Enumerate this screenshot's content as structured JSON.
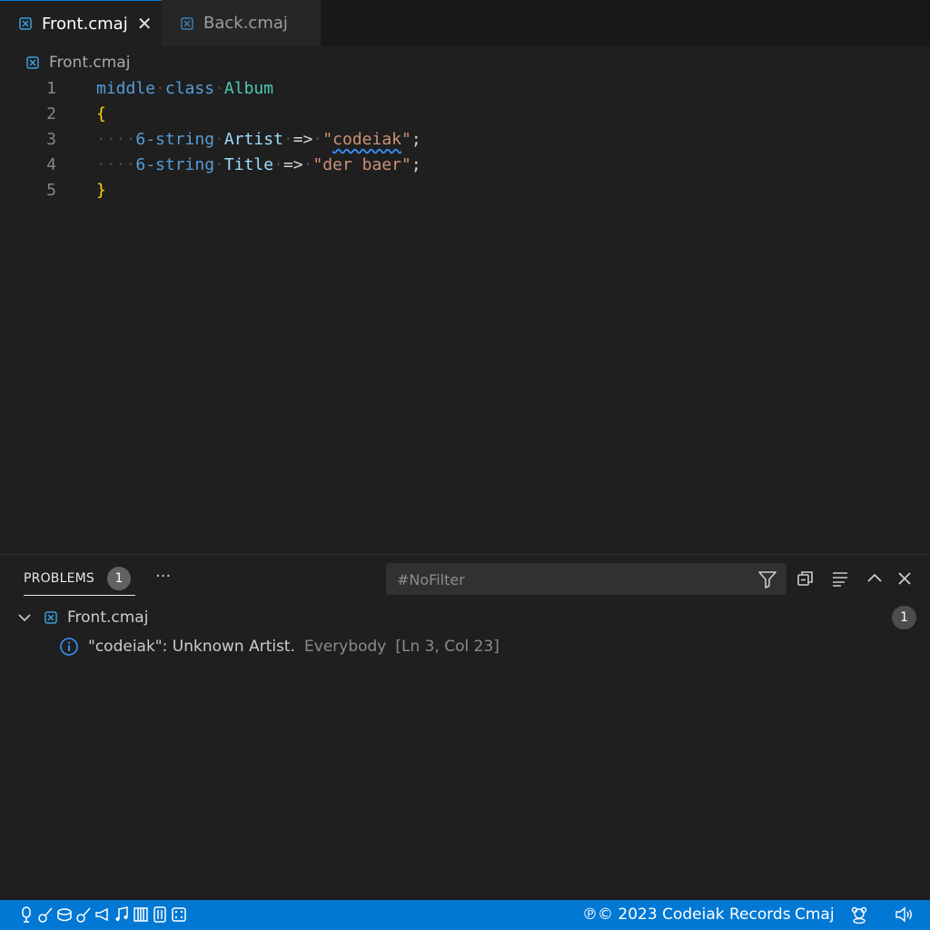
{
  "tabs": [
    {
      "label": "Front.cmaj",
      "active": true
    },
    {
      "label": "Back.cmaj",
      "active": false
    }
  ],
  "breadcrumb": {
    "label": "Front.cmaj"
  },
  "editor": {
    "lines": [
      {
        "num": "1"
      },
      {
        "num": "2"
      },
      {
        "num": "3"
      },
      {
        "num": "4"
      },
      {
        "num": "5"
      }
    ],
    "tokens": {
      "l1_kw1": "middle",
      "l1_kw2": "class",
      "l1_cls": "Album",
      "l2_brace": "{",
      "l3_type": "6-string",
      "l3_id": "Artist",
      "l3_op": "=>",
      "l3_q1": "\"",
      "l3_str": "codeiak",
      "l3_q2": "\"",
      "l3_semi": ";",
      "l4_type": "6-string",
      "l4_id": "Title",
      "l4_op": "=>",
      "l4_str": "\"der baer\"",
      "l4_semi": ";",
      "l5_brace": "}"
    }
  },
  "panel": {
    "tab_label": "PROBLEMS",
    "tab_badge": "1",
    "more": "···",
    "filter_placeholder": "#NoFilter",
    "tree": {
      "file": "Front.cmaj",
      "count": "1"
    },
    "problem": {
      "message": "\"codeiak\": Unknown Artist.",
      "source": "Everybody",
      "location": "[Ln 3, Col 23]"
    }
  },
  "statusbar": {
    "copyright": "℗© 2023 Codeiak Records",
    "language": "Cmaj",
    "icons": [
      "microphone-icon",
      "guitar-icon",
      "drum-icon",
      "guitar-icon",
      "megaphone-icon",
      "notes-icon",
      "piano-icon",
      "sliders-icon",
      "dice-icon"
    ]
  },
  "colors": {
    "accent": "#0078d4",
    "info": "#3794ff"
  }
}
